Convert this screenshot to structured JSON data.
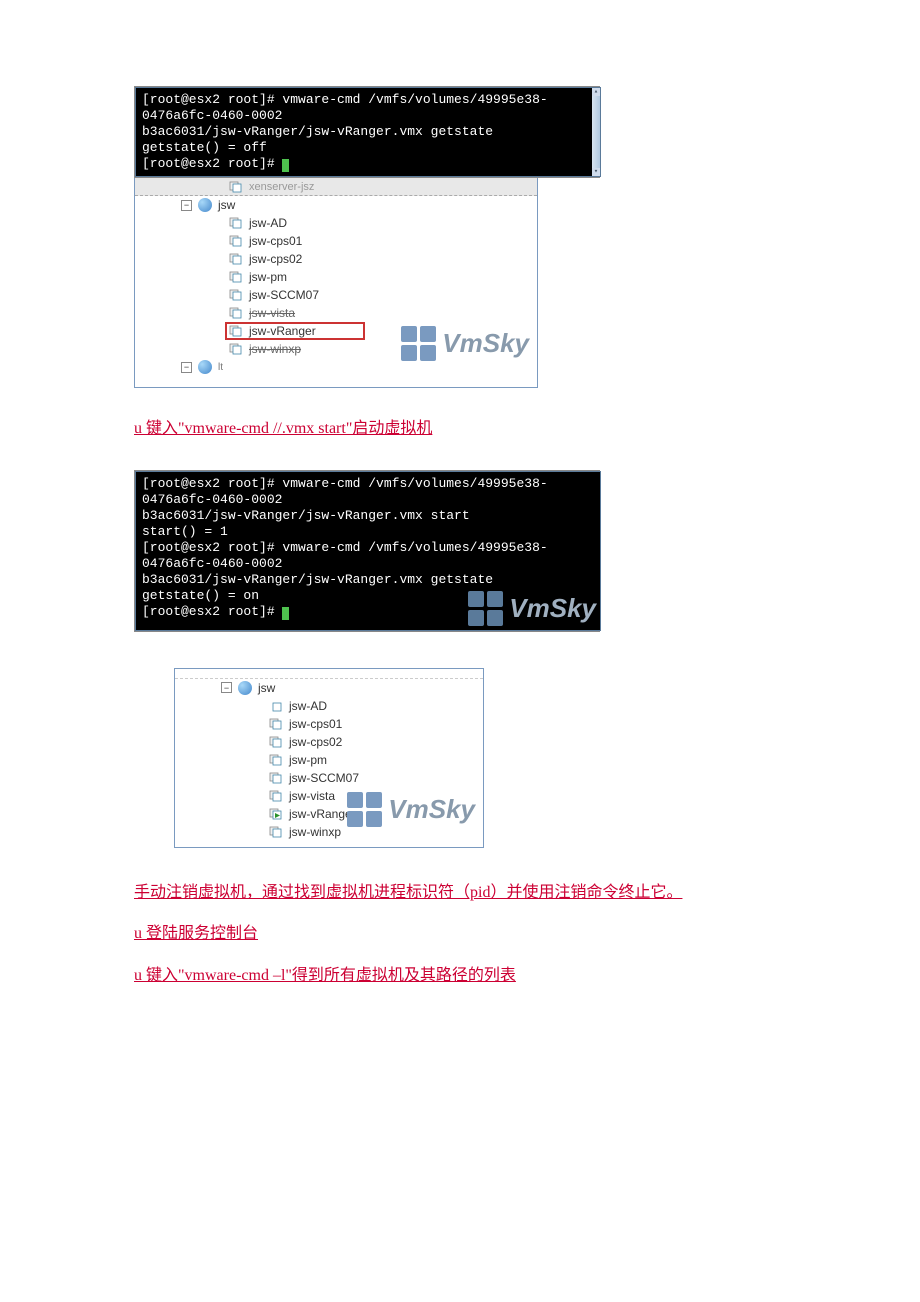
{
  "terminal1": {
    "line1": "[root@esx2 root]# vmware-cmd /vmfs/volumes/49995e38-0476a6fc-0460-0002",
    "line2": "b3ac6031/jsw-vRanger/jsw-vRanger.vmx getstate",
    "line3": "getstate() = off",
    "line4": "[root@esx2 root]# "
  },
  "tree1": {
    "truncated_label": "xenserver-jsz",
    "root": "jsw",
    "items": [
      "jsw-AD",
      "jsw-cps01",
      "jsw-cps02",
      "jsw-pm",
      "jsw-SCCM07",
      "jsw-vista",
      "jsw-vRanger",
      "jsw-winxp"
    ],
    "highlighted_index": 6
  },
  "instruction1": "u 键入\"vmware-cmd //.vmx start\"启动虚拟机",
  "terminal2": {
    "line1": "[root@esx2 root]# vmware-cmd /vmfs/volumes/49995e38-0476a6fc-0460-0002",
    "line2": "b3ac6031/jsw-vRanger/jsw-vRanger.vmx start",
    "line3": "start() = 1",
    "line4": "[root@esx2 root]# vmware-cmd /vmfs/volumes/49995e38-0476a6fc-0460-0002",
    "line5": "b3ac6031/jsw-vRanger/jsw-vRanger.vmx getstate",
    "line6": "getstate() = on",
    "line7": "[root@esx2 root]# "
  },
  "tree2": {
    "root": "jsw",
    "items": [
      "jsw-AD",
      "jsw-cps01",
      "jsw-cps02",
      "jsw-pm",
      "jsw-SCCM07",
      "jsw-vista",
      "jsw-vRanger",
      "jsw-winxp"
    ],
    "running_index": 6
  },
  "instruction2": "手动注销虚拟机，通过找到虚拟机进程标识符（pid）并使用注销命令终止它。",
  "instruction3": "u 登陆服务控制台",
  "instruction4": "u 键入\"vmware-cmd –l\"得到所有虚拟机及其路径的列表",
  "watermark": "VmSky"
}
